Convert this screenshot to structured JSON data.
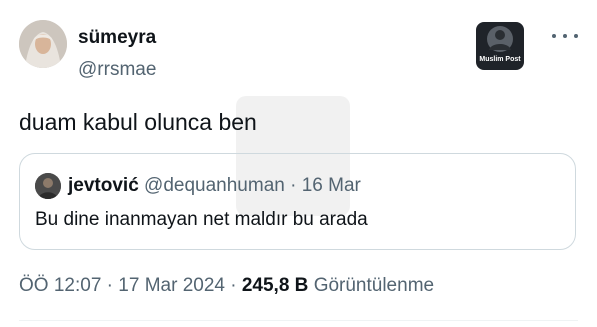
{
  "tweet": {
    "author": {
      "name": "sümeyra",
      "handle": "@rrsmae"
    },
    "badge_label": "Muslim Post",
    "text": "duam kabul olunca ben",
    "quoted": {
      "name": "jevtović",
      "handle": "@dequanhuman",
      "separator": "·",
      "date": "16 Mar",
      "text": "Bu dine inanmayan net maldır bu arada"
    },
    "time": "ÖÖ 12:07",
    "sep1": "·",
    "date": "17 Mar 2024",
    "sep2": "·",
    "views_count": "245,8 B",
    "views_label": "Görüntülenme"
  },
  "icons": {
    "more": "more-dots-icon"
  },
  "colors": {
    "text": "#0f1419",
    "secondary": "#536471",
    "border": "#cfd9de"
  }
}
